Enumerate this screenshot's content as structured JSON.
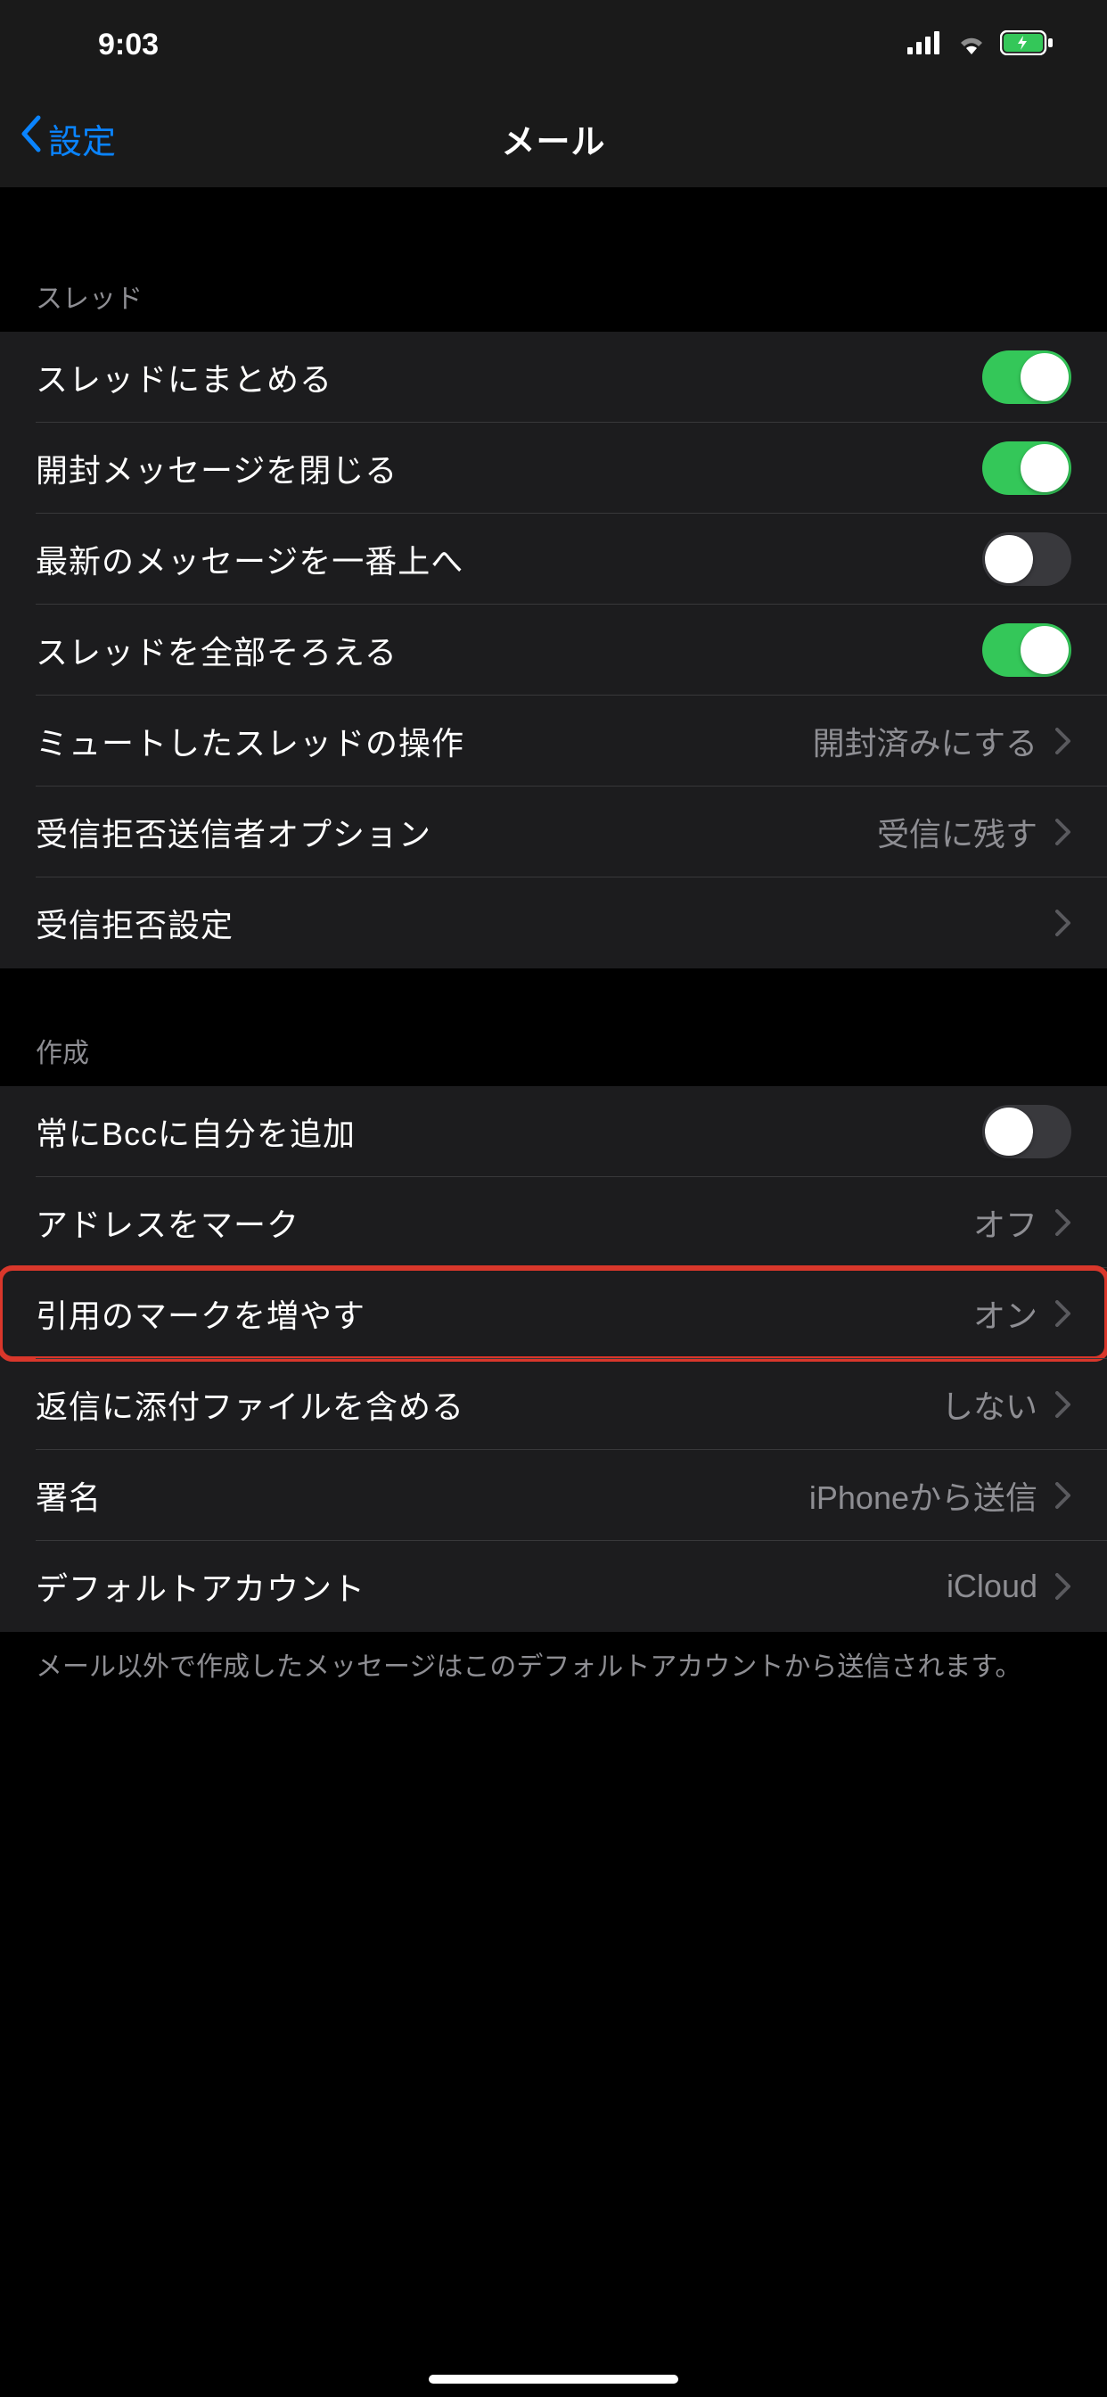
{
  "status": {
    "time": "9:03"
  },
  "nav": {
    "back_label": "設定",
    "title": "メール"
  },
  "sections": {
    "thread": {
      "header": "スレッド",
      "organize_by_thread": {
        "label": "スレッドにまとめる",
        "on": true
      },
      "collapse_read": {
        "label": "開封メッセージを閉じる",
        "on": true
      },
      "most_recent_on_top": {
        "label": "最新のメッセージを一番上へ",
        "on": false
      },
      "complete_threads": {
        "label": "スレッドを全部そろえる",
        "on": true
      },
      "muted_action": {
        "label": "ミュートしたスレッドの操作",
        "value": "開封済みにする"
      },
      "blocked_options": {
        "label": "受信拒否送信者オプション",
        "value": "受信に残す"
      },
      "blocked_settings": {
        "label": "受信拒否設定"
      }
    },
    "compose": {
      "header": "作成",
      "always_bcc": {
        "label": "常にBccに自分を追加",
        "on": false
      },
      "mark_addresses": {
        "label": "アドレスをマーク",
        "value": "オフ"
      },
      "increase_quote": {
        "label": "引用のマークを増やす",
        "value": "オン"
      },
      "include_attachments": {
        "label": "返信に添付ファイルを含める",
        "value": "しない"
      },
      "signature": {
        "label": "署名",
        "value": "iPhoneから送信"
      },
      "default_account": {
        "label": "デフォルトアカウント",
        "value": "iCloud"
      },
      "footer": "メール以外で作成したメッセージはこのデフォルトアカウントから送信されます。"
    }
  }
}
